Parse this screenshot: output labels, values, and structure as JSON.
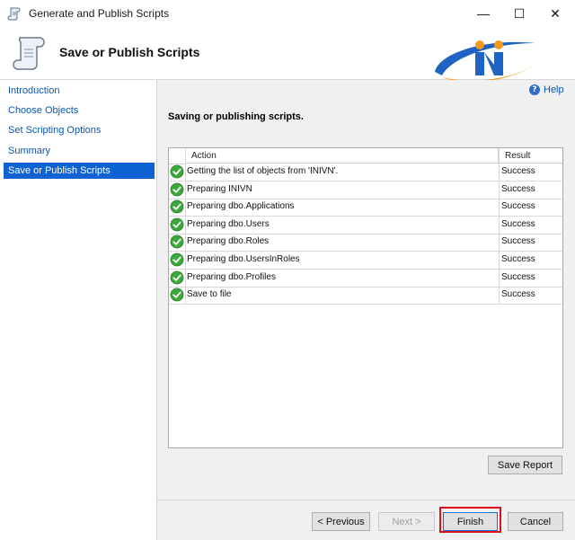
{
  "window": {
    "title": "Generate and Publish Scripts",
    "title_icon": "scroll-icon"
  },
  "controls": {
    "minimize": "—",
    "maximize": "☐",
    "close": "✕"
  },
  "header": {
    "title": "Save or Publish Scripts",
    "logo_text": "iNi"
  },
  "help": {
    "label": "Help"
  },
  "sidebar": {
    "items": [
      {
        "label": "Introduction",
        "active": false
      },
      {
        "label": "Choose Objects",
        "active": false
      },
      {
        "label": "Set Scripting Options",
        "active": false
      },
      {
        "label": "Summary",
        "active": false
      },
      {
        "label": "Save or Publish Scripts",
        "active": true
      }
    ]
  },
  "main": {
    "section_title": "Saving or publishing scripts.",
    "table": {
      "columns": [
        "Action",
        "Result"
      ],
      "rows": [
        {
          "action": "Getting the list of objects from 'INIVN'.",
          "result": "Success"
        },
        {
          "action": "Preparing INIVN",
          "result": "Success"
        },
        {
          "action": "Preparing dbo.Applications",
          "result": "Success"
        },
        {
          "action": "Preparing dbo.Users",
          "result": "Success"
        },
        {
          "action": "Preparing dbo.Roles",
          "result": "Success"
        },
        {
          "action": "Preparing dbo.UsersInRoles",
          "result": "Success"
        },
        {
          "action": "Preparing dbo.Profiles",
          "result": "Success"
        },
        {
          "action": "Save to file",
          "result": "Success"
        }
      ]
    }
  },
  "buttons": {
    "save_report": "Save Report",
    "previous": "< Previous",
    "next": "Next >",
    "finish": "Finish",
    "cancel": "Cancel"
  },
  "colors": {
    "accent": "#0d63d3",
    "success": "#3aa83a",
    "highlight": "#e0101a",
    "link": "#0b56b5"
  }
}
